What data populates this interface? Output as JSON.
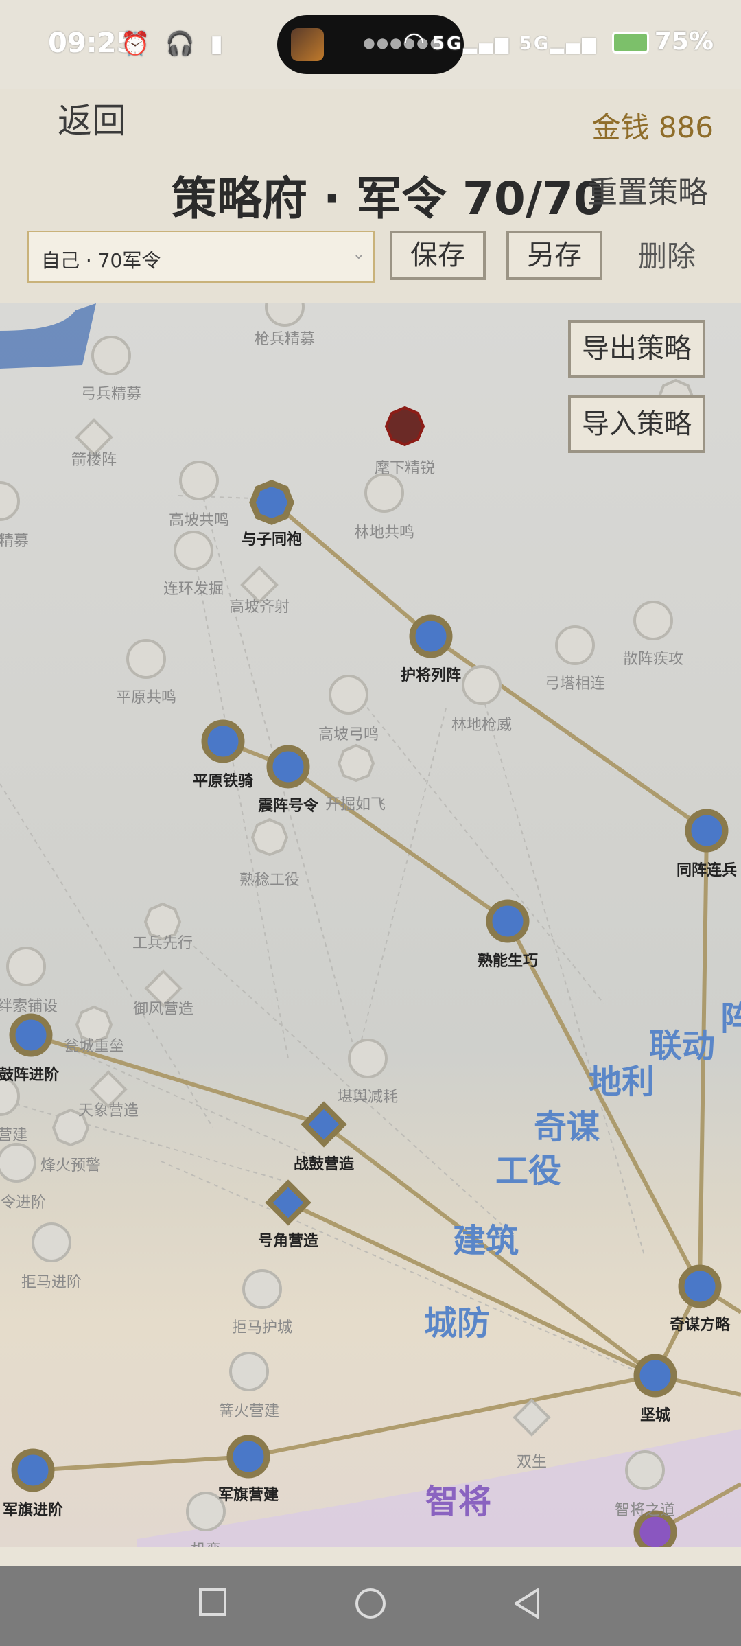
{
  "status": {
    "time": "09:25",
    "left_icons": "⏰ 🎧 ▮",
    "signal": "5G",
    "battery": "75%"
  },
  "header": {
    "back": "返回",
    "money": "金钱 886",
    "title": "策略府 · 军令 70/70",
    "reset": "重置策略",
    "preset_value": "自己 · 70军令",
    "save": "保存",
    "save_as": "另存",
    "delete": "删除"
  },
  "map_buttons": {
    "export": "导出策略",
    "import": "导入策略"
  },
  "nodes": [
    {
      "label": "枪兵精募",
      "state": "inactive"
    },
    {
      "label": "弓兵精募",
      "state": "inactive"
    },
    {
      "label": "箭楼阵",
      "state": "inactive"
    },
    {
      "label": "麾下精锐",
      "state": "red"
    },
    {
      "label": "精募",
      "state": "inactive"
    },
    {
      "label": "高坡共鸣",
      "state": "inactive"
    },
    {
      "label": "与子同袍",
      "state": "active"
    },
    {
      "label": "林地共鸣",
      "state": "inactive"
    },
    {
      "label": "连环发掘",
      "state": "inactive"
    },
    {
      "label": "高坡齐射",
      "state": "inactive"
    },
    {
      "label": "护将列阵",
      "state": "active"
    },
    {
      "label": "弓塔相连",
      "state": "inactive"
    },
    {
      "label": "散阵疾攻",
      "state": "inactive"
    },
    {
      "label": "平原共鸣",
      "state": "inactive"
    },
    {
      "label": "高坡弓鸣",
      "state": "inactive"
    },
    {
      "label": "林地枪威",
      "state": "inactive"
    },
    {
      "label": "平原铁骑",
      "state": "active"
    },
    {
      "label": "震阵号令",
      "state": "active"
    },
    {
      "label": "开掘如飞",
      "state": "inactive"
    },
    {
      "label": "熟稔工役",
      "state": "inactive"
    },
    {
      "label": "同阵连兵",
      "state": "active"
    },
    {
      "label": "工兵先行",
      "state": "inactive"
    },
    {
      "label": "熟能生巧",
      "state": "active"
    },
    {
      "label": "御风营造",
      "state": "inactive"
    },
    {
      "label": "绊索铺设",
      "state": "inactive"
    },
    {
      "label": "瓮城重垒",
      "state": "inactive"
    },
    {
      "label": "鼓阵进阶",
      "state": "active"
    },
    {
      "label": "天象营造",
      "state": "inactive"
    },
    {
      "label": "堪舆减耗",
      "state": "inactive"
    },
    {
      "label": "营建",
      "state": "inactive"
    },
    {
      "label": "烽火预警",
      "state": "inactive"
    },
    {
      "label": "战鼓营造",
      "state": "active"
    },
    {
      "label": "令进阶",
      "state": "inactive"
    },
    {
      "label": "号角营造",
      "state": "active"
    },
    {
      "label": "拒马进阶",
      "state": "inactive"
    },
    {
      "label": "拒马护城",
      "state": "inactive"
    },
    {
      "label": "奇谋方略",
      "state": "active"
    },
    {
      "label": "篝火营建",
      "state": "inactive"
    },
    {
      "label": "坚城",
      "state": "active"
    },
    {
      "label": "双生",
      "state": "inactive"
    },
    {
      "label": "军旗营建",
      "state": "active"
    },
    {
      "label": "军旗进阶",
      "state": "active"
    },
    {
      "label": "智将之道",
      "state": "inactive"
    },
    {
      "label": "机变",
      "state": "inactive"
    }
  ],
  "categories": [
    "联动",
    "阵",
    "地利",
    "奇谋",
    "工役",
    "建筑",
    "城防",
    "智将"
  ],
  "colors": {
    "active_fill": "#4a78c8",
    "active_ring": "#8a7a4c",
    "inactive": "#dcdad4",
    "link": "#a89563",
    "category_blue": "#5a86c8",
    "category_purple": "#8a63c0",
    "money": "#8f6d2a"
  },
  "navbar": {
    "icons": [
      "square-icon",
      "circle-icon",
      "back-triangle-icon"
    ]
  }
}
